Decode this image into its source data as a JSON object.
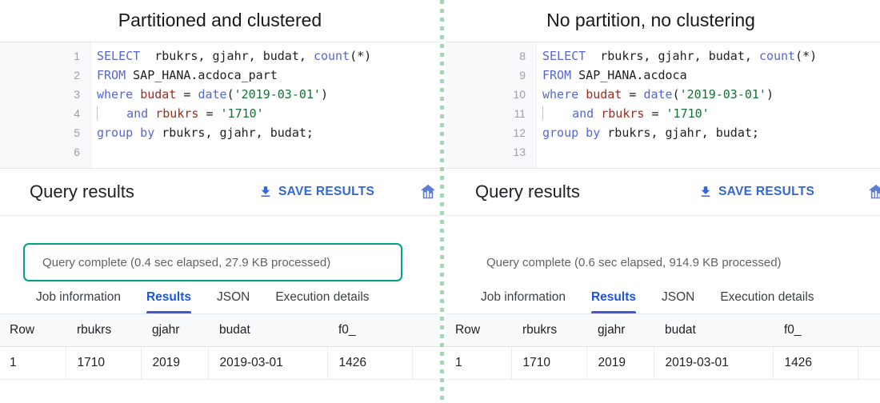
{
  "divider": {
    "color": "#a8d5b5"
  },
  "accent": {
    "link": "#3367d6",
    "tab_active": "#1a56db",
    "highlight_border": "#00a383"
  },
  "panels": [
    {
      "title": "Partitioned and clustered",
      "editor": {
        "lines": [
          {
            "num": "1",
            "tokens": [
              {
                "t": "SELECT",
                "c": "kw"
              },
              {
                "t": "  rbukrs, gjahr, budat, ",
                "c": "plain"
              },
              {
                "t": "count",
                "c": "fn"
              },
              {
                "t": "(*)",
                "c": "plain"
              }
            ]
          },
          {
            "num": "2",
            "tokens": [
              {
                "t": "FROM",
                "c": "kw"
              },
              {
                "t": " SAP_HANA.acdoca_part",
                "c": "plain"
              }
            ]
          },
          {
            "num": "3",
            "tokens": [
              {
                "t": "where",
                "c": "kw"
              },
              {
                "t": " ",
                "c": "plain"
              },
              {
                "t": "budat",
                "c": "col"
              },
              {
                "t": " = ",
                "c": "plain"
              },
              {
                "t": "date",
                "c": "fn"
              },
              {
                "t": "(",
                "c": "plain"
              },
              {
                "t": "'2019-03-01'",
                "c": "str"
              },
              {
                "t": ")",
                "c": "plain"
              }
            ]
          },
          {
            "num": "4",
            "caret": true,
            "tokens": [
              {
                "t": "    ",
                "c": "plain"
              },
              {
                "t": "and",
                "c": "kw"
              },
              {
                "t": " ",
                "c": "plain"
              },
              {
                "t": "rbukrs",
                "c": "col"
              },
              {
                "t": " = ",
                "c": "plain"
              },
              {
                "t": "'1710'",
                "c": "str"
              }
            ]
          },
          {
            "num": "5",
            "tokens": [
              {
                "t": "group by",
                "c": "kw"
              },
              {
                "t": " rbukrs, gjahr, budat;",
                "c": "plain"
              }
            ]
          },
          {
            "num": "6",
            "tokens": []
          }
        ]
      },
      "results": {
        "title": "Query results",
        "save_label": "SAVE RESULTS",
        "save_icon": "download-icon",
        "explore_icon": "explore-data-chart-icon",
        "status": "Query complete (0.4 sec elapsed, 27.9 KB processed)",
        "status_highlighted": true,
        "tabs": [
          {
            "label": "Job information",
            "active": false
          },
          {
            "label": "Results",
            "active": true
          },
          {
            "label": "JSON",
            "active": false
          },
          {
            "label": "Execution details",
            "active": false
          }
        ],
        "table": {
          "columns": [
            "Row",
            "rbukrs",
            "gjahr",
            "budat",
            "f0_",
            ""
          ],
          "rows": [
            [
              "1",
              "1710",
              "2019",
              "2019-03-01",
              "1426",
              ""
            ]
          ]
        }
      }
    },
    {
      "title": "No partition, no clustering",
      "editor": {
        "lines": [
          {
            "num": "8",
            "tokens": [
              {
                "t": "SELECT",
                "c": "kw"
              },
              {
                "t": "  rbukrs, gjahr, budat, ",
                "c": "plain"
              },
              {
                "t": "count",
                "c": "fn"
              },
              {
                "t": "(*)",
                "c": "plain"
              }
            ]
          },
          {
            "num": "9",
            "tokens": [
              {
                "t": "FROM",
                "c": "kw"
              },
              {
                "t": " SAP_HANA.acdoca",
                "c": "plain"
              }
            ]
          },
          {
            "num": "10",
            "tokens": [
              {
                "t": "where",
                "c": "kw"
              },
              {
                "t": " ",
                "c": "plain"
              },
              {
                "t": "budat",
                "c": "col"
              },
              {
                "t": " = ",
                "c": "plain"
              },
              {
                "t": "date",
                "c": "fn"
              },
              {
                "t": "(",
                "c": "plain"
              },
              {
                "t": "'2019-03-01'",
                "c": "str"
              },
              {
                "t": ")",
                "c": "plain"
              }
            ]
          },
          {
            "num": "11",
            "caret": true,
            "tokens": [
              {
                "t": "    ",
                "c": "plain"
              },
              {
                "t": "and",
                "c": "kw"
              },
              {
                "t": " ",
                "c": "plain"
              },
              {
                "t": "rbukrs",
                "c": "col"
              },
              {
                "t": " = ",
                "c": "plain"
              },
              {
                "t": "'1710'",
                "c": "str"
              }
            ]
          },
          {
            "num": "12",
            "tokens": [
              {
                "t": "group by",
                "c": "kw"
              },
              {
                "t": " rbukrs, gjahr, budat;",
                "c": "plain"
              }
            ]
          },
          {
            "num": "13",
            "tokens": []
          }
        ]
      },
      "results": {
        "title": "Query results",
        "save_label": "SAVE RESULTS",
        "save_icon": "download-icon",
        "explore_icon": "explore-data-chart-icon",
        "status": "Query complete (0.6 sec elapsed, 914.9 KB processed)",
        "status_highlighted": false,
        "tabs": [
          {
            "label": "Job information",
            "active": false
          },
          {
            "label": "Results",
            "active": true
          },
          {
            "label": "JSON",
            "active": false
          },
          {
            "label": "Execution details",
            "active": false
          }
        ],
        "table": {
          "columns": [
            "Row",
            "rbukrs",
            "gjahr",
            "budat",
            "f0_",
            ""
          ],
          "rows": [
            [
              "1",
              "1710",
              "2019",
              "2019-03-01",
              "1426",
              ""
            ]
          ]
        }
      }
    }
  ]
}
